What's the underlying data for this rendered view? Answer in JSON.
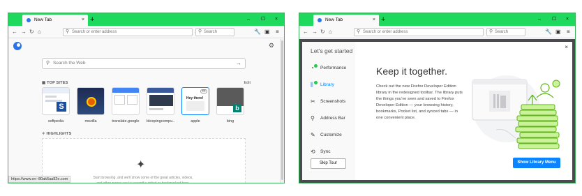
{
  "left": {
    "tab": {
      "title": "New Tab",
      "close": "×"
    },
    "newtab": "+",
    "window_controls": {
      "minimize": "–",
      "maximize": "☐",
      "close": "×"
    },
    "nav": {
      "back": "←",
      "forward": "→",
      "reload": "↻",
      "home": "⌂"
    },
    "url": {
      "placeholder": "Search or enter address"
    },
    "search": {
      "placeholder": "Search"
    },
    "toolbar_icons": {
      "tools": "🔧",
      "sidebar": "▣",
      "menu": "≡"
    },
    "web_search": {
      "placeholder": "Search the Web",
      "arrow": "→"
    },
    "top_sites": {
      "label": "TOP SITES",
      "edit": "Edit",
      "items": [
        {
          "label": "softpedia"
        },
        {
          "label": "mozilla"
        },
        {
          "label": "translate.google"
        },
        {
          "label": "bleepingcompu..."
        },
        {
          "label": "apple"
        },
        {
          "label": "bing"
        }
      ]
    },
    "highlights": {
      "label": "HIGHLIGHTS",
      "empty_text": "Start browsing, and we'll show some of the great articles, videos, and other pages you've recently visited or bookmarked here."
    },
    "status_url": "https://www.xn--80ak6aa92e.com"
  },
  "right": {
    "tab": {
      "title": "New Tab",
      "close": "×"
    },
    "newtab": "+",
    "window_controls": {
      "minimize": "–",
      "maximize": "☐",
      "close": "×"
    },
    "nav": {
      "back": "←",
      "forward": "→",
      "reload": "↻",
      "home": "⌂"
    },
    "url": {
      "placeholder": "Search or enter address"
    },
    "search": {
      "placeholder": "Search"
    },
    "toolbar_icons": {
      "tools": "🔧",
      "sidebar": "▣",
      "menu": "≡"
    },
    "modal": {
      "heading": "Let's get started",
      "close": "×",
      "menu": [
        {
          "label": "Performance",
          "icon": "speedometer-icon",
          "glyph": "◔"
        },
        {
          "label": "Library",
          "icon": "library-icon",
          "glyph": "⫼"
        },
        {
          "label": "Screenshots",
          "icon": "scissors-icon",
          "glyph": "✂"
        },
        {
          "label": "Address Bar",
          "icon": "search-icon",
          "glyph": "⚲"
        },
        {
          "label": "Customize",
          "icon": "brush-icon",
          "glyph": "✎"
        },
        {
          "label": "Sync",
          "icon": "sync-icon",
          "glyph": "⟲"
        }
      ],
      "skip": "Skip Tour",
      "title": "Keep it together.",
      "body": "Check out the new Firefox Developer Edition library in the redesigned toolbar. The library puts the things you've seen and saved to Firefox Developer Edition — your browsing history, bookmarks, Pocket list, and synced tabs — in one convenient place.",
      "button": "Show Library Menu"
    }
  },
  "colors": {
    "titlebar": "#1fd85e",
    "accent": "#0a84ff",
    "overlay": "#4a4a4f",
    "illustration": "#7ed321"
  }
}
